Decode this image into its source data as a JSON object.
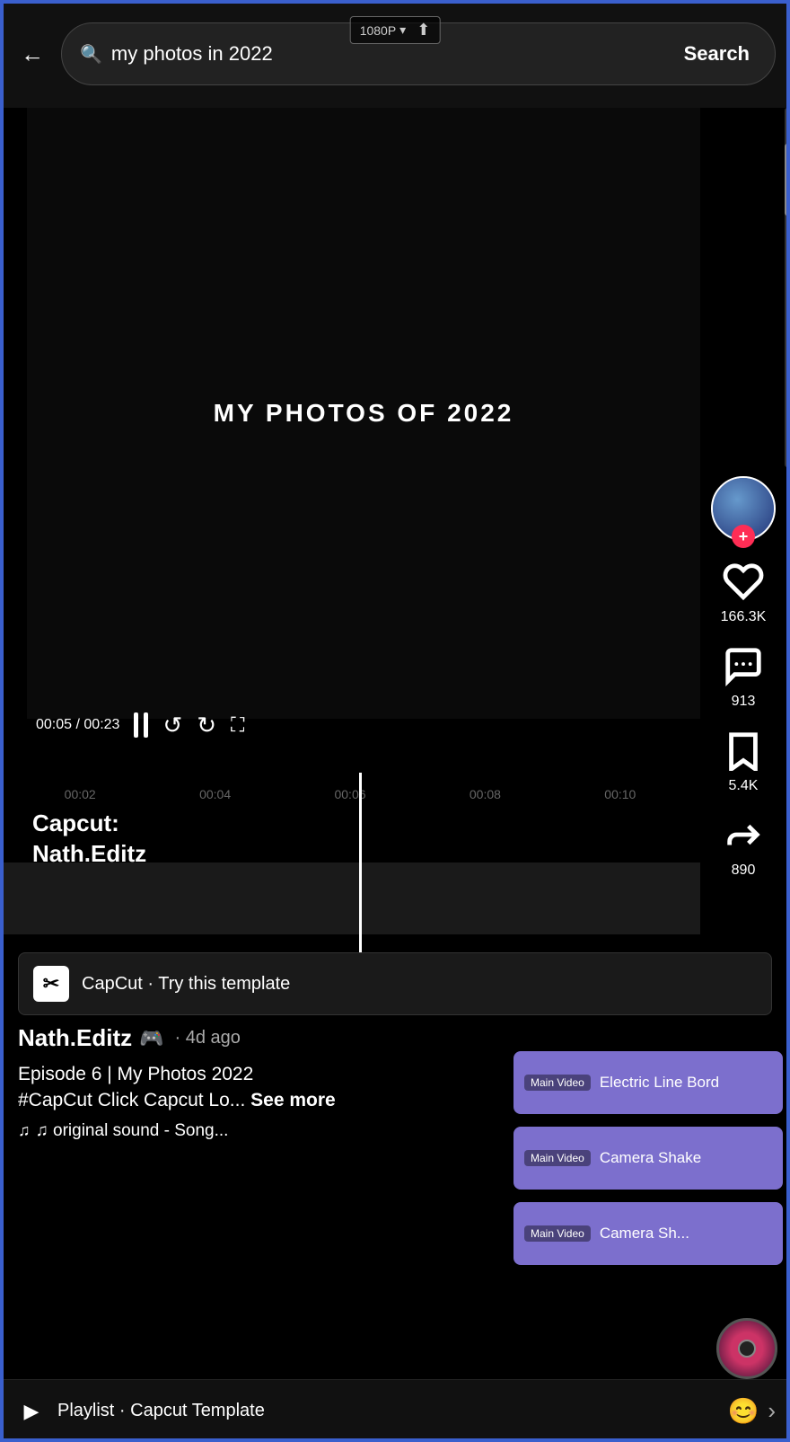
{
  "topBar": {
    "searchPlaceholder": "my photos in 2022",
    "searchValue": "my photos in 2022",
    "searchButtonLabel": "Search",
    "qualityLabel": "1080P",
    "closeLabel": "✕",
    "backLabel": "←"
  },
  "video": {
    "titleOverlay": "MY PHOTOS OF 2022",
    "currentTime": "00:05",
    "totalTime": "00:23"
  },
  "actions": {
    "likeCount": "166.3K",
    "commentCount": "913",
    "bookmarkCount": "5.4K",
    "shareCount": "890"
  },
  "timeline": {
    "markers": [
      "00:02",
      "00:04",
      "00:06",
      "00:08",
      "00:10"
    ]
  },
  "capcut": {
    "overlayLine1": "Capcut:",
    "overlayLine2": "Nath.Editz",
    "bannerText": "CapCut · Try this template",
    "logoText": "✂"
  },
  "userInfo": {
    "username": "Nath.Editz",
    "badgeEmoji": "🟢",
    "timeAgo": "· 4d ago",
    "captionLine1": "Episode 6 | My Photos 2022",
    "captionLine2": "#CapCut Click Capcut Lo...",
    "seeMore": "See more",
    "soundText": "♫ original sound - Song...",
    "musicNote": "♫"
  },
  "templatePanel": {
    "items": [
      {
        "badge": "Main Video",
        "label": "Electric Line Bord",
        "count": ""
      },
      {
        "badge": "Main Video",
        "label": "Camera Shake",
        "count": ""
      },
      {
        "badge": "Main Video",
        "label": "Camera Sh...",
        "count": ""
      }
    ],
    "shareCount": "890"
  },
  "bottomBar": {
    "playlistText": "Playlist · Capcut Template",
    "playlistIcon": "▶",
    "chevron": "›"
  }
}
